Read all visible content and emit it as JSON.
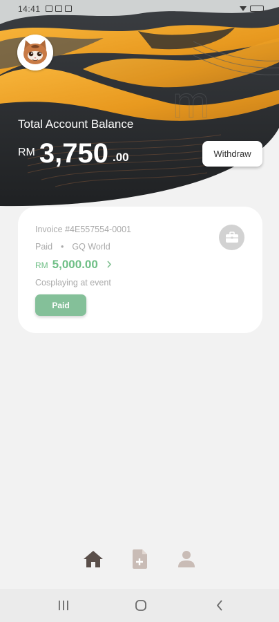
{
  "status_bar": {
    "time": "14:41"
  },
  "balance": {
    "label": "Total Account Balance",
    "currency": "RM",
    "amount": "3,750",
    "cents": ".00",
    "withdraw_label": "Withdraw"
  },
  "invoice": {
    "number": "Invoice #4E557554-0001",
    "status": "Paid",
    "separator": "•",
    "client": "GQ World",
    "currency": "RM",
    "amount": "5,000.00",
    "description": "Cosplaying at event",
    "badge_label": "Paid"
  },
  "colors": {
    "accent_green": "#84c099",
    "amount_green": "#6fbf86",
    "nav_active": "#5a4f4a",
    "nav_inactive": "#c9bcb6",
    "hero_orange": "#f0a52a",
    "hero_dark": "#2e3134"
  },
  "icons": {
    "avatar": "cat-avatar-icon",
    "briefcase": "briefcase-icon",
    "nav_home": "home-icon",
    "nav_invoice": "add-document-icon",
    "nav_profile": "person-icon",
    "sys_recents": "recent-apps-icon",
    "sys_home": "home-circle-icon",
    "sys_back": "back-chevron-icon"
  }
}
